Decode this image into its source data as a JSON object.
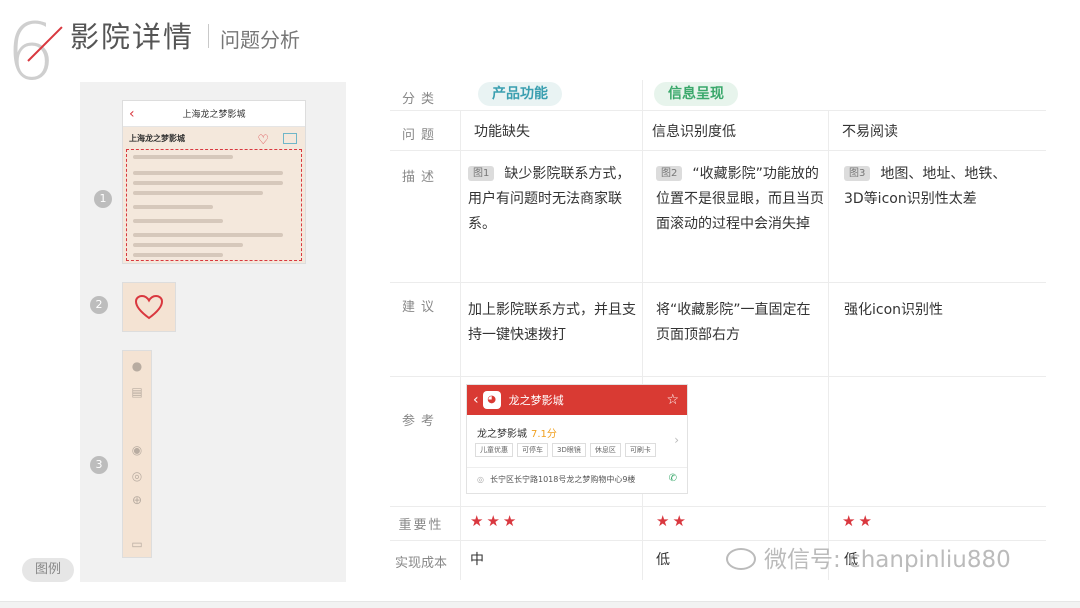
{
  "header": {
    "number": "6",
    "title": "影院详情",
    "subtitle": "问题分析"
  },
  "legend": {
    "tag": "图例",
    "phone_title": "上海龙之梦影城",
    "phone_cinema": "上海龙之梦影城",
    "items": [
      "1",
      "2",
      "3"
    ],
    "icons": [
      "map-pin-icon",
      "bus-icon",
      "3d-icon",
      "imax-icon",
      "food-icon",
      "cart-icon"
    ]
  },
  "table": {
    "row_labels": {
      "category": "分类",
      "problem": "问题",
      "description": "描述",
      "suggestion": "建议",
      "reference": "参考",
      "importance": "重要性",
      "cost": "实现成本"
    },
    "categories": [
      "产品功能",
      "信息呈现"
    ],
    "columns": [
      {
        "problem": "功能缺失",
        "fig": "图1",
        "description": "缺少影院联系方式，用户有问题时无法商家联系。",
        "suggestion": "加上影院联系方式，并且支持一键快速拨打",
        "stars": "★★★",
        "cost": "中"
      },
      {
        "problem": "信息识别度低",
        "fig": "图2",
        "description": "“收藏影院”功能放的位置不是很显眼，而且当页面滚动的过程中会消失掉",
        "suggestion": "将“收藏影院”一直固定在页面顶部右方",
        "stars": "★★",
        "cost": "低"
      },
      {
        "problem": "不易阅读",
        "fig": "图3",
        "description": "地图、地址、地铁、3D等icon识别性太差",
        "suggestion": "强化icon识别性",
        "stars": "★★",
        "cost": "低"
      }
    ],
    "reference": {
      "bar_title": "龙之梦影城",
      "name": "龙之梦影城",
      "score": "7.1分",
      "tags": [
        "儿童优惠",
        "可停车",
        "3D眼镜",
        "休息区",
        "可刷卡"
      ],
      "address": "长宁区长宁路1018号龙之梦购物中心9楼"
    }
  },
  "watermark": "微信号: chanpinliu880",
  "colors": {
    "accent_red": "#d9383f",
    "pill_teal": "#3a9fb0",
    "pill_green": "#3aa86b"
  }
}
